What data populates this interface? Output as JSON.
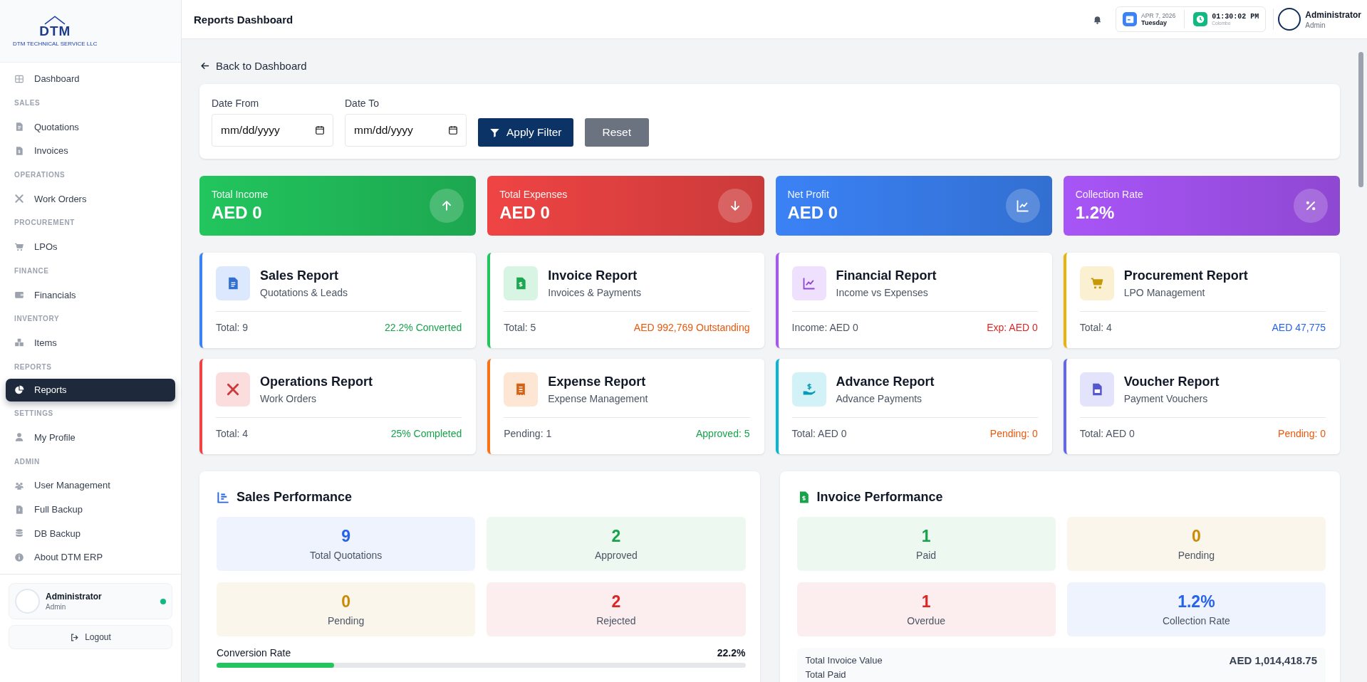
{
  "sidebar": {
    "logo": {
      "mark": "DTM",
      "caption": "DTM TECHNICAL SERVICE LLC"
    },
    "nav": [
      {
        "kind": "link",
        "label": "Dashboard",
        "selected": false
      },
      {
        "kind": "section",
        "label": "SALES"
      },
      {
        "kind": "link",
        "label": "Quotations",
        "selected": false
      },
      {
        "kind": "link",
        "label": "Invoices",
        "selected": false
      },
      {
        "kind": "section",
        "label": "OPERATIONS"
      },
      {
        "kind": "link",
        "label": "Work Orders",
        "selected": false
      },
      {
        "kind": "section",
        "label": "PROCUREMENT"
      },
      {
        "kind": "link",
        "label": "LPOs",
        "selected": false
      },
      {
        "kind": "section",
        "label": "FINANCE"
      },
      {
        "kind": "link",
        "label": "Financials",
        "selected": false
      },
      {
        "kind": "section",
        "label": "INVENTORY"
      },
      {
        "kind": "link",
        "label": "Items",
        "selected": false
      },
      {
        "kind": "section",
        "label": "REPORTS"
      },
      {
        "kind": "link",
        "label": "Reports",
        "selected": true
      },
      {
        "kind": "section",
        "label": "SETTINGS"
      },
      {
        "kind": "link",
        "label": "My Profile",
        "selected": false
      },
      {
        "kind": "section",
        "label": "ADMIN"
      },
      {
        "kind": "link",
        "label": "User Management",
        "selected": false
      },
      {
        "kind": "link",
        "label": "Full Backup",
        "selected": false
      },
      {
        "kind": "link",
        "label": "DB Backup",
        "selected": false
      },
      {
        "kind": "link",
        "label": "About DTM ERP",
        "selected": false
      }
    ],
    "user": {
      "name": "Administrator",
      "role": "Admin",
      "online": true
    },
    "logout": "Logout"
  },
  "header": {
    "title": "Reports Dashboard",
    "date": "APR 7, 2026",
    "day": "Tuesday",
    "time": "01:30:02 PM",
    "zone": "Colombo",
    "user": "Administrator",
    "role": "Admin"
  },
  "back_link": "Back to Dashboard",
  "filter": {
    "fields": [
      {
        "label": "Date From",
        "placeholder": "mm/dd/yyyy"
      },
      {
        "label": "Date To",
        "placeholder": "mm/dd/yyyy"
      }
    ],
    "apply": "Apply Filter",
    "reset": "Reset"
  },
  "stats": [
    {
      "label": "Total Income",
      "value": "AED 0",
      "color": "#22c55e"
    },
    {
      "label": "Total Expenses",
      "value": "AED 0",
      "color": "#ef4444"
    },
    {
      "label": "Net Profit",
      "value": "AED 0",
      "color": "#3b82f6"
    },
    {
      "label": "Collection Rate",
      "value": "1.2%",
      "color": "#a855f7"
    }
  ],
  "reports": [
    {
      "title": "Sales Report",
      "subtitle": "Quotations & Leads",
      "left": "Total: 9",
      "color": "#3b82f6",
      "metric": {
        "text": "22.2% Converted",
        "color": "#16a34a"
      }
    },
    {
      "title": "Invoice Report",
      "subtitle": "Invoices & Payments",
      "left": "Total: 5",
      "color": "#22c55e",
      "metric": {
        "text": "AED 992,769 Outstanding",
        "color": "#ea580c"
      }
    },
    {
      "title": "Financial Report",
      "subtitle": "Income vs Expenses",
      "left": "Income: AED 0",
      "color": "#a855f7",
      "metric": {
        "text": "Exp: AED 0",
        "color": "#dc2626"
      }
    },
    {
      "title": "Procurement Report",
      "subtitle": "LPO Management",
      "left": "Total: 4",
      "color": "#eab308",
      "metric": {
        "text": "AED 47,775",
        "color": "#2563eb"
      }
    },
    {
      "title": "Operations Report",
      "subtitle": "Work Orders",
      "left": "Total: 4",
      "color": "#ef4444",
      "metric": {
        "text": "25% Completed",
        "color": "#16a34a"
      }
    },
    {
      "title": "Expense Report",
      "subtitle": "Expense Management",
      "left": "Pending: 1",
      "color": "#f97316",
      "metric": {
        "text": "Approved: 5",
        "color": "#16a34a"
      }
    },
    {
      "title": "Advance Report",
      "subtitle": "Advance Payments",
      "left": "Total: AED 0",
      "color": "#06b6d4",
      "metric": {
        "text": "Pending: 0",
        "color": "#ea580c"
      }
    },
    {
      "title": "Voucher Report",
      "subtitle": "Payment Vouchers",
      "left": "Total: AED 0",
      "color": "#6366f1",
      "metric": {
        "text": "Pending: 0",
        "color": "#ea580c"
      }
    }
  ],
  "panels": [
    {
      "title": "Sales Performance",
      "tiles": [
        {
          "value": "9",
          "label": "Total Quotations",
          "color": "#2563eb"
        },
        {
          "value": "2",
          "label": "Approved",
          "color": "#16a34a"
        },
        {
          "value": "0",
          "label": "Pending",
          "color": "#ca8a04"
        },
        {
          "value": "2",
          "label": "Rejected",
          "color": "#dc2626"
        }
      ],
      "progress": {
        "label": "Conversion Rate",
        "value": "22.2%",
        "level": 0.222
      }
    },
    {
      "title": "Invoice Performance",
      "tiles": [
        {
          "value": "1",
          "label": "Paid",
          "color": "#16a34a"
        },
        {
          "value": "0",
          "label": "Pending",
          "color": "#ca8a04"
        },
        {
          "value": "1",
          "label": "Overdue",
          "color": "#dc2626"
        },
        {
          "value": "1.2%",
          "label": "Collection Rate",
          "color": "#2563eb"
        }
      ],
      "totals": [
        {
          "label": "Total Invoice Value",
          "value": "AED 1,014,418.75"
        },
        {
          "label": "Total Paid"
        }
      ]
    }
  ]
}
